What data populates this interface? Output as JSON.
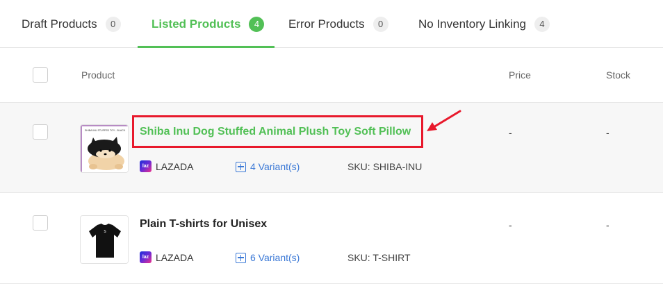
{
  "tabs": [
    {
      "label": "Draft Products",
      "count": "0"
    },
    {
      "label": "Listed Products",
      "count": "4"
    },
    {
      "label": "Error Products",
      "count": "0"
    },
    {
      "label": "No Inventory Linking",
      "count": "4"
    }
  ],
  "table": {
    "columns": {
      "product": "Product",
      "price": "Price",
      "stock": "Stock"
    },
    "rows": [
      {
        "title": "Shiba Inu Dog Stuffed Animal Plush Toy Soft Pillow",
        "platform": "LAZADA",
        "variants": "4 Variant(s)",
        "sku": "SKU: SHIBA-INU",
        "price": "-",
        "stock": "-",
        "thumb_icon": "shiba-plush-icon",
        "thumb_caption": "SHIBA INU STUFFED TOY - BLACK"
      },
      {
        "title": "Plain T-shirts for Unisex",
        "platform": "LAZADA",
        "variants": "6 Variant(s)",
        "sku": "SKU: T-SHIRT",
        "price": "-",
        "stock": "-",
        "thumb_icon": "black-tshirt-icon",
        "thumb_caption": "S"
      }
    ]
  },
  "platform_icon_text": "laz",
  "colors": {
    "accent": "#52c056",
    "link": "#3a78d6",
    "annotation": "#e8192c"
  }
}
